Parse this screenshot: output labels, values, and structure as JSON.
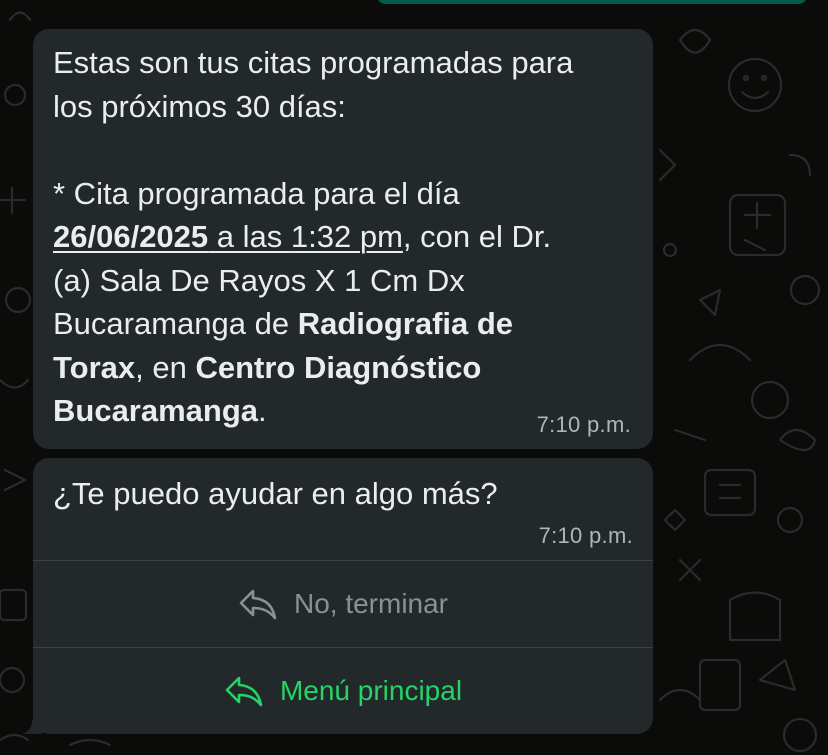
{
  "messages": [
    {
      "intro": [
        "Estas son tus citas programadas para",
        "los próximos 30 días:"
      ],
      "appointment": {
        "prefix": " * Cita programada para el día",
        "date": "26/06/2025",
        "at": " a las ",
        "time": "1:32 pm",
        "doctor_intro": ", con el Dr.",
        "doctor_line1": "(a) Sala De Rayos X 1 Cm Dx",
        "doctor_line2": "Bucaramanga de ",
        "exam_part1": "Radiografia de",
        "exam_part2": "Torax",
        "en": ", en ",
        "center_part1": "Centro Diagnóstico",
        "center_part2": "Bucaramanga",
        "end": "."
      },
      "timestamp": "7:10 p.m."
    },
    {
      "text": "¿Te puedo ayudar en algo más?",
      "timestamp": "7:10 p.m.",
      "buttons": [
        {
          "label": "No, terminar",
          "icon": "reply-arrow-icon",
          "color": "#8a9196"
        },
        {
          "label": "Menú principal",
          "icon": "reply-arrow-icon",
          "color": "#25d366"
        }
      ]
    }
  ],
  "colors": {
    "bubble": "#23282b",
    "background": "#0b0b0a",
    "accent": "#25d366",
    "outgoing_bubble": "#005c4b"
  }
}
